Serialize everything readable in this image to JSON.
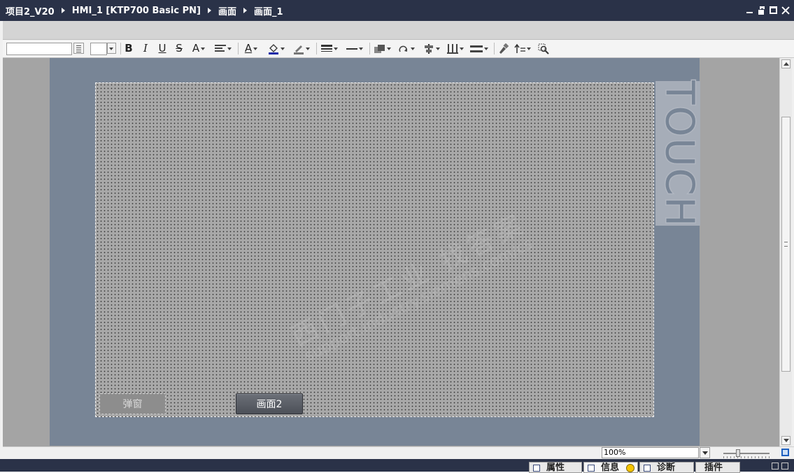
{
  "breadcrumb": {
    "items": [
      "项目2_V20",
      "HMI_1 [KTP700 Basic PN]",
      "画面",
      "画面_1"
    ]
  },
  "toolbar": {
    "bold": "B",
    "italic": "I",
    "underline": "U",
    "strike": "S",
    "font_grow": "A",
    "font_color": "A"
  },
  "screen": {
    "buttons": {
      "popup_label": "弹窗",
      "screen2_label": "画面2"
    },
    "watermark_line1": "西门子工业  找答案",
    "watermark_line2": "support.industry.siemens.com/cs"
  },
  "device": {
    "brand_label": "TOUCH"
  },
  "zoom": {
    "value": "100%"
  },
  "inspector_tabs": {
    "properties": "属性",
    "info": "信息",
    "diagnostics": "诊断",
    "plugins": "插件"
  },
  "colors": {
    "titlebar": "#2a3248",
    "device_frame": "#788596",
    "screen_background": "#a8a8a8",
    "button_dark": "#5a5e66"
  }
}
